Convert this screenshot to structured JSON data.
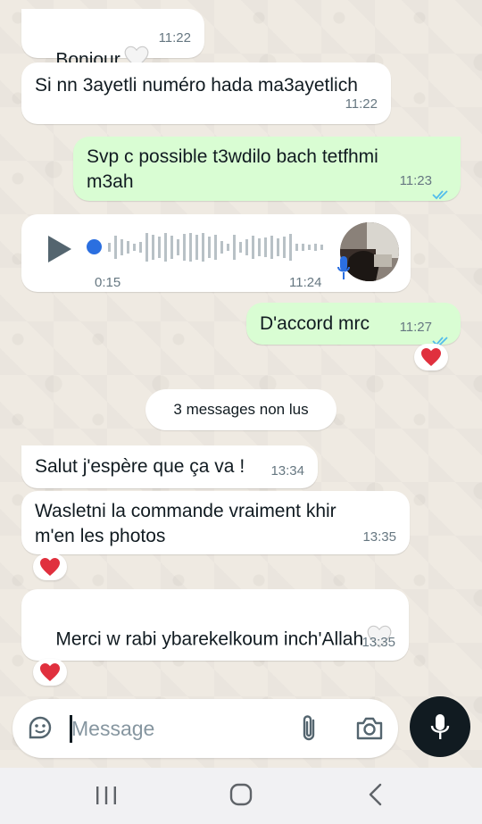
{
  "messages": [
    {
      "text": "Bonjour",
      "time": "11:22",
      "emoji": "white-heart"
    },
    {
      "text": "Si nn 3ayetli numéro hada ma3ayetlich",
      "time": "11:22"
    },
    {
      "text": "Svp c possible t3wdilo bach tetfhmi\nm3ah",
      "time": "11:23",
      "status": "read"
    },
    {
      "voice_duration": "0:15",
      "time": "11:24"
    },
    {
      "text": "D'accord mrc",
      "time": "11:27",
      "status": "read",
      "reaction": "red-heart"
    },
    {
      "text": "Salut j'espère que ça va !",
      "time": "13:34"
    },
    {
      "text": "Wasletni la commande vraiment khir\nm'en les photos",
      "time": "13:35",
      "reaction": "red-heart"
    },
    {
      "text": "Merci w rabi ybarekelkoum inch'Allah",
      "time": "13:35",
      "emoji": "white-heart",
      "reaction": "red-heart"
    }
  ],
  "unread_banner": "3 messages non lus",
  "input": {
    "placeholder": "Message"
  },
  "colors": {
    "incoming": "#ffffff",
    "outgoing": "#d9fdd3",
    "read_ticks": "#53bdeb",
    "voice_dot": "#2b6fe0",
    "background": "#efeae2"
  }
}
